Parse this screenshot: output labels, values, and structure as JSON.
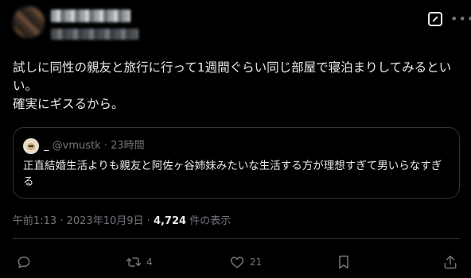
{
  "tweet": {
    "text": "試しに同性の親友と旅行に行って1週間ぐらい同じ部屋で寝泊まりしてみるといい。\n確実にギスるから。"
  },
  "quote": {
    "display_name": "_",
    "handle": "@vmustk",
    "separator": "·",
    "time": "23時間",
    "text": "正直結婚生活よりも親友と阿佐ヶ谷姉妹みたいな生活する方が理想すぎて男いらなすぎる"
  },
  "meta": {
    "time": "午前1:13",
    "separator": "·",
    "date": "2023年10月9日",
    "views_count": "4,724",
    "views_label": "件の表示"
  },
  "actions": {
    "reply_count": "",
    "retweet_count": "4",
    "like_count": "21"
  },
  "colors": {
    "background": "#000000",
    "text": "#e7e9ea",
    "secondary": "#71767b",
    "border": "#2f3336"
  }
}
